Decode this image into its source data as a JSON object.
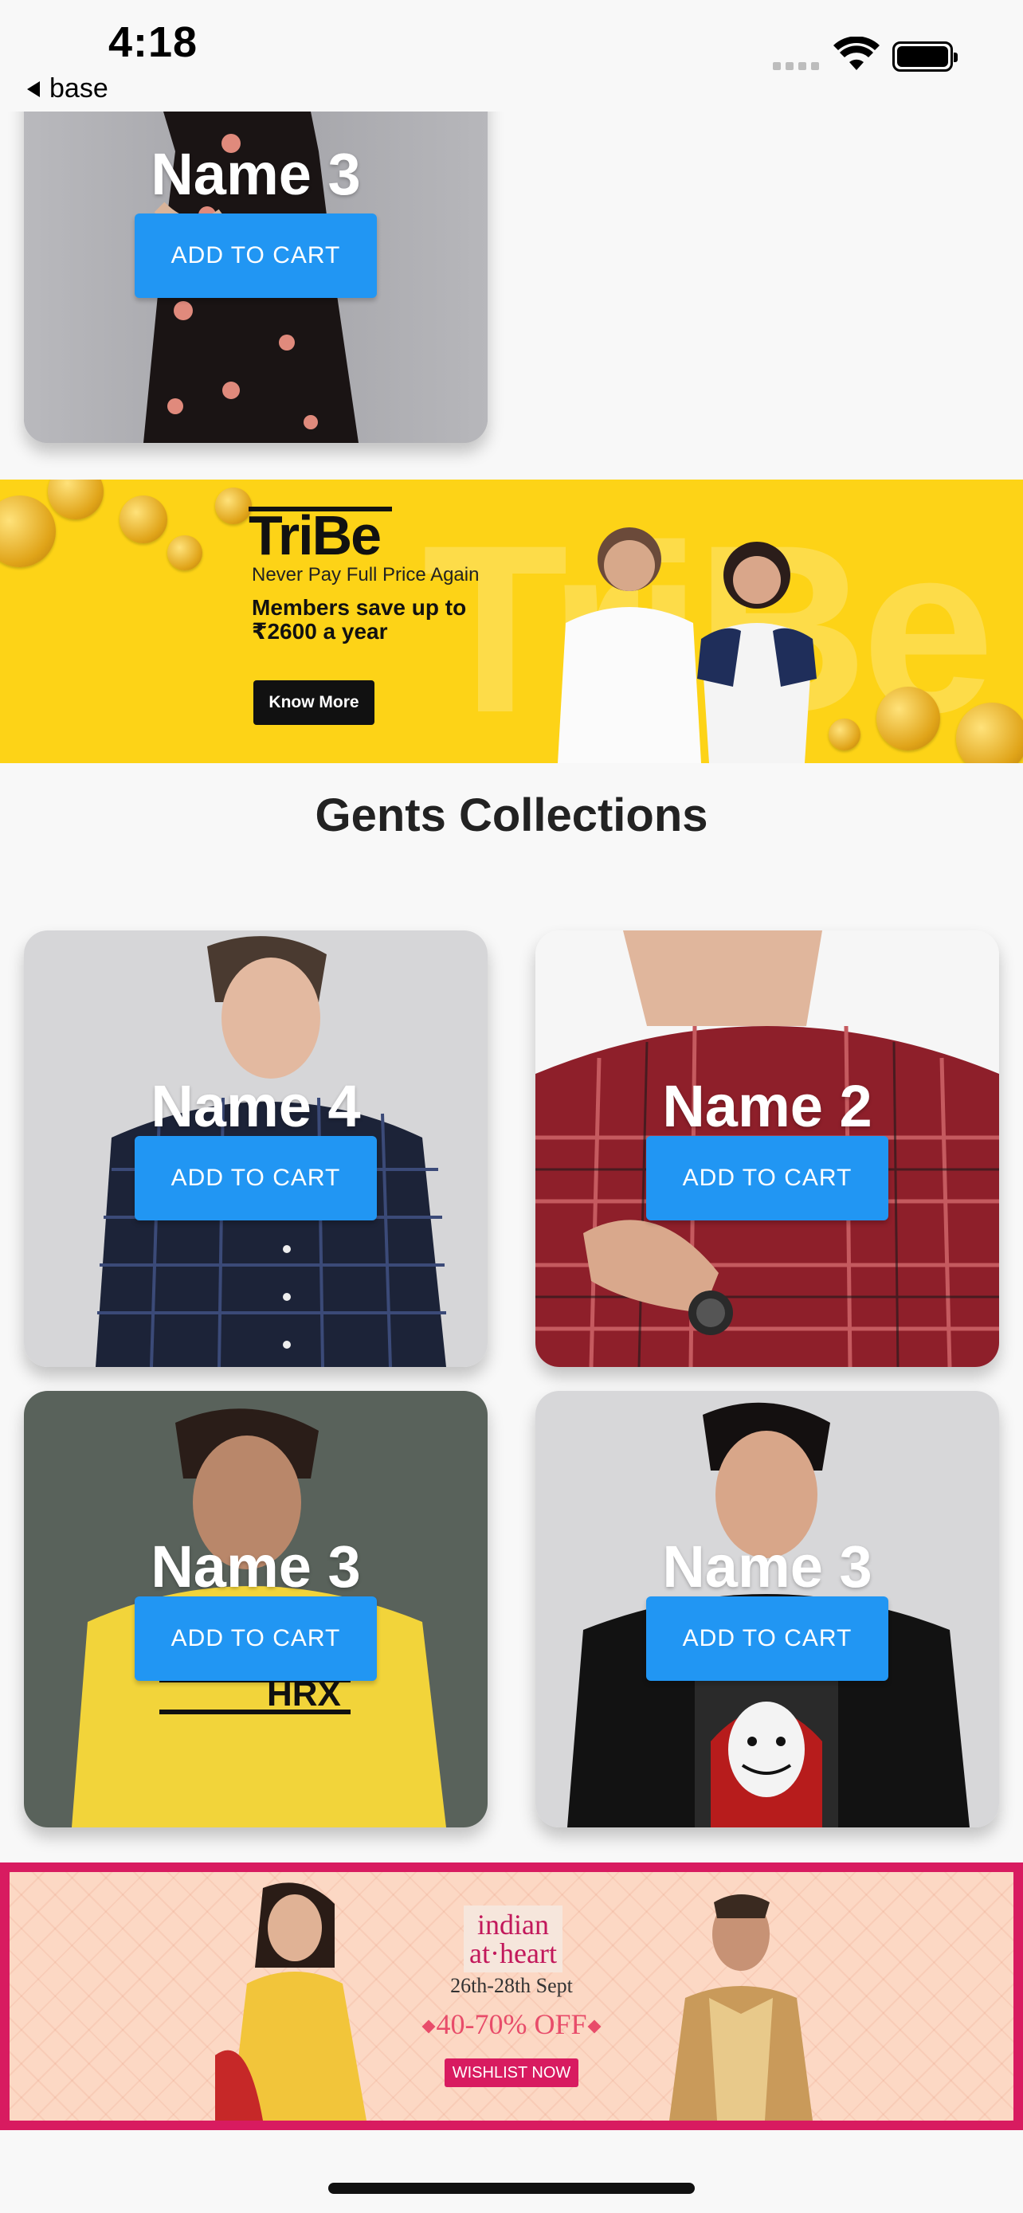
{
  "status_bar": {
    "time": "4:18",
    "back_label": "base"
  },
  "top_card": {
    "name": "Name 3",
    "button": "ADD TO CART"
  },
  "tribe_banner": {
    "logo": "TriBe",
    "watermark": "TriBe",
    "tagline": "Never Pay Full Price Again",
    "offer_line1": "Members save up to",
    "offer_line2": "₹2600 a year",
    "cta": "Know More"
  },
  "gents": {
    "title": "Gents Collections",
    "cards": [
      {
        "name": "Name 4",
        "button": "ADD TO CART"
      },
      {
        "name": "Name 2",
        "button": "ADD TO CART"
      },
      {
        "name": "Name 3",
        "button": "ADD TO CART"
      },
      {
        "name": "Name 3",
        "button": "ADD TO CART"
      }
    ]
  },
  "indian_banner": {
    "brand_line1": "indian",
    "brand_line2": "at·heart",
    "dates": "26th-28th Sept",
    "discount": "40-70% OFF",
    "cta": "WISHLIST NOW"
  },
  "colors": {
    "accent": "#2196f3",
    "tribe_yellow": "#fdd317",
    "indian_pink": "#d81b60"
  }
}
